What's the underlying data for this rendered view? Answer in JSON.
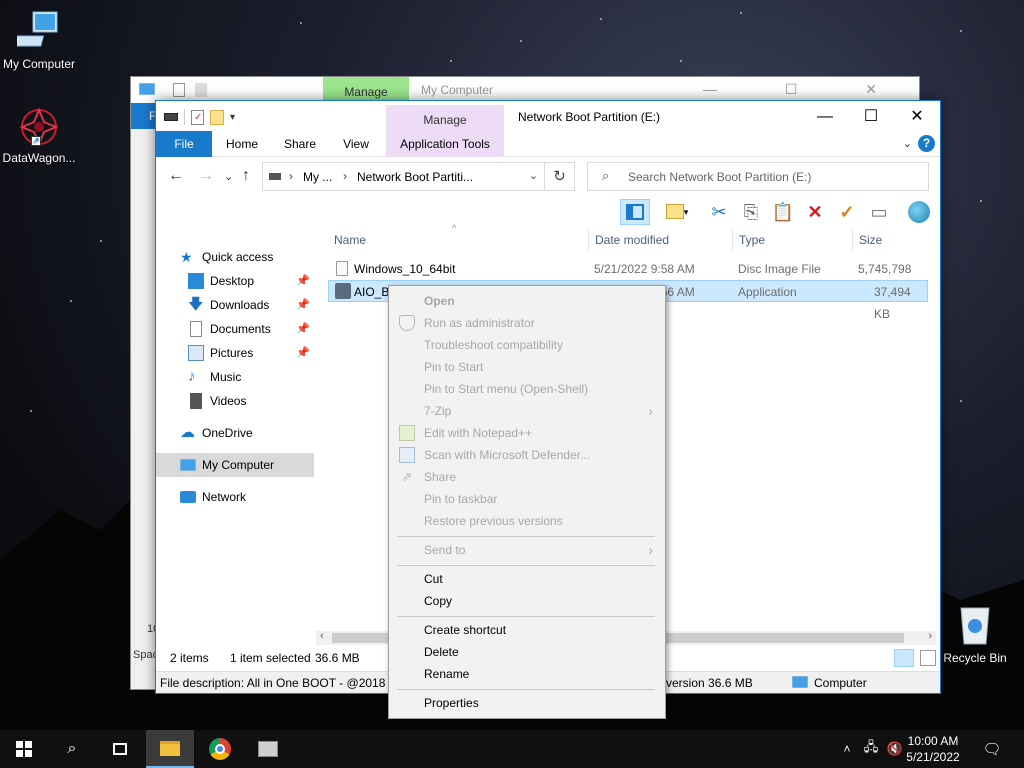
{
  "desktop": {
    "icons": [
      {
        "label": "My Computer",
        "icon": "monitor-icon"
      },
      {
        "label": "DataWagon...",
        "icon": "datawagon-icon"
      },
      {
        "label": "Recycle Bin",
        "icon": "recycle-bin-icon"
      }
    ]
  },
  "back_window": {
    "manage_label": "Manage",
    "title": "My Computer",
    "file_tab": "F",
    "side_text_1": "10",
    "side_text_2": "Spac"
  },
  "window": {
    "title": "Network Boot Partition (E:)",
    "context_tab_group": "Manage",
    "tabs": [
      "File",
      "Home",
      "Share",
      "View",
      "Application Tools"
    ],
    "address": {
      "crumb1": "My ...",
      "crumb2": "Network Boot Partiti..."
    },
    "search_placeholder": "Search Network Boot Partition (E:)",
    "nav": [
      {
        "label": "Quick access",
        "icon": "star-icon",
        "color": "#1979ca"
      },
      {
        "label": "Desktop",
        "icon": "desktop-icon",
        "color": "#2b8ad8",
        "pinned": true
      },
      {
        "label": "Downloads",
        "icon": "download-icon",
        "color": "#1e6fc1",
        "pinned": true
      },
      {
        "label": "Documents",
        "icon": "document-icon",
        "color": "#888888",
        "pinned": true
      },
      {
        "label": "Pictures",
        "icon": "picture-icon",
        "color": "#5a8cbf",
        "pinned": true
      },
      {
        "label": "Music",
        "icon": "music-icon",
        "color": "#2a7fd4"
      },
      {
        "label": "Videos",
        "icon": "video-icon",
        "color": "#555555"
      },
      {
        "label": "OneDrive",
        "icon": "cloud-icon",
        "color": "#1979ca"
      },
      {
        "label": "My Computer",
        "icon": "computer-icon",
        "color": "#2b8ad8"
      },
      {
        "label": "Network",
        "icon": "network-icon",
        "color": "#2b8ad8"
      }
    ],
    "columns": [
      "Name",
      "Date modified",
      "Type",
      "Size"
    ],
    "files": [
      {
        "name": "Windows_10_64bit",
        "date": "5/21/2022 9:58 AM",
        "type": "Disc Image File",
        "size": "5,745,798 KB"
      },
      {
        "name": "AIO_Boot_Extractor",
        "date": "5/21/2022 9:56 AM",
        "type": "Application",
        "size": "37,494 KB"
      }
    ],
    "status": {
      "items": "2 items",
      "selected": "1 item selected",
      "size": "36.6 MB"
    },
    "description": {
      "left": "File description: All in One BOOT - @2018 w",
      "right": "version 36.6 MB",
      "location": "Computer"
    }
  },
  "context_menu": {
    "items": [
      {
        "label": "Open",
        "disabled": true,
        "bold": true
      },
      {
        "label": "Run as administrator",
        "disabled": true,
        "icon": "shield-icon"
      },
      {
        "label": "Troubleshoot compatibility",
        "disabled": true
      },
      {
        "label": "Pin to Start",
        "disabled": true
      },
      {
        "label": "Pin to Start menu (Open-Shell)",
        "disabled": true
      },
      {
        "label": "7-Zip",
        "disabled": true,
        "submenu": true
      },
      {
        "label": "Edit with Notepad++",
        "disabled": true,
        "icon": "notepad-icon"
      },
      {
        "label": "Scan with Microsoft Defender...",
        "disabled": true,
        "icon": "defender-icon"
      },
      {
        "label": "Share",
        "disabled": true,
        "icon": "share-icon"
      },
      {
        "label": "Pin to taskbar",
        "disabled": true
      },
      {
        "label": "Restore previous versions",
        "disabled": true
      },
      {
        "label": "Send to",
        "disabled": true,
        "submenu": true
      },
      {
        "label": "Cut",
        "disabled": false
      },
      {
        "label": "Copy",
        "disabled": false
      },
      {
        "label": "Create shortcut",
        "disabled": false
      },
      {
        "label": "Delete",
        "disabled": false
      },
      {
        "label": "Rename",
        "disabled": false
      },
      {
        "label": "Properties",
        "disabled": false
      }
    ]
  },
  "taskbar": {
    "time": "10:00 AM",
    "date": "5/21/2022"
  },
  "colors": {
    "accent": "#1979ca",
    "selection": "#cce8ff",
    "manage_green": "#9be58f",
    "manage_purple": "#eedcf6"
  }
}
